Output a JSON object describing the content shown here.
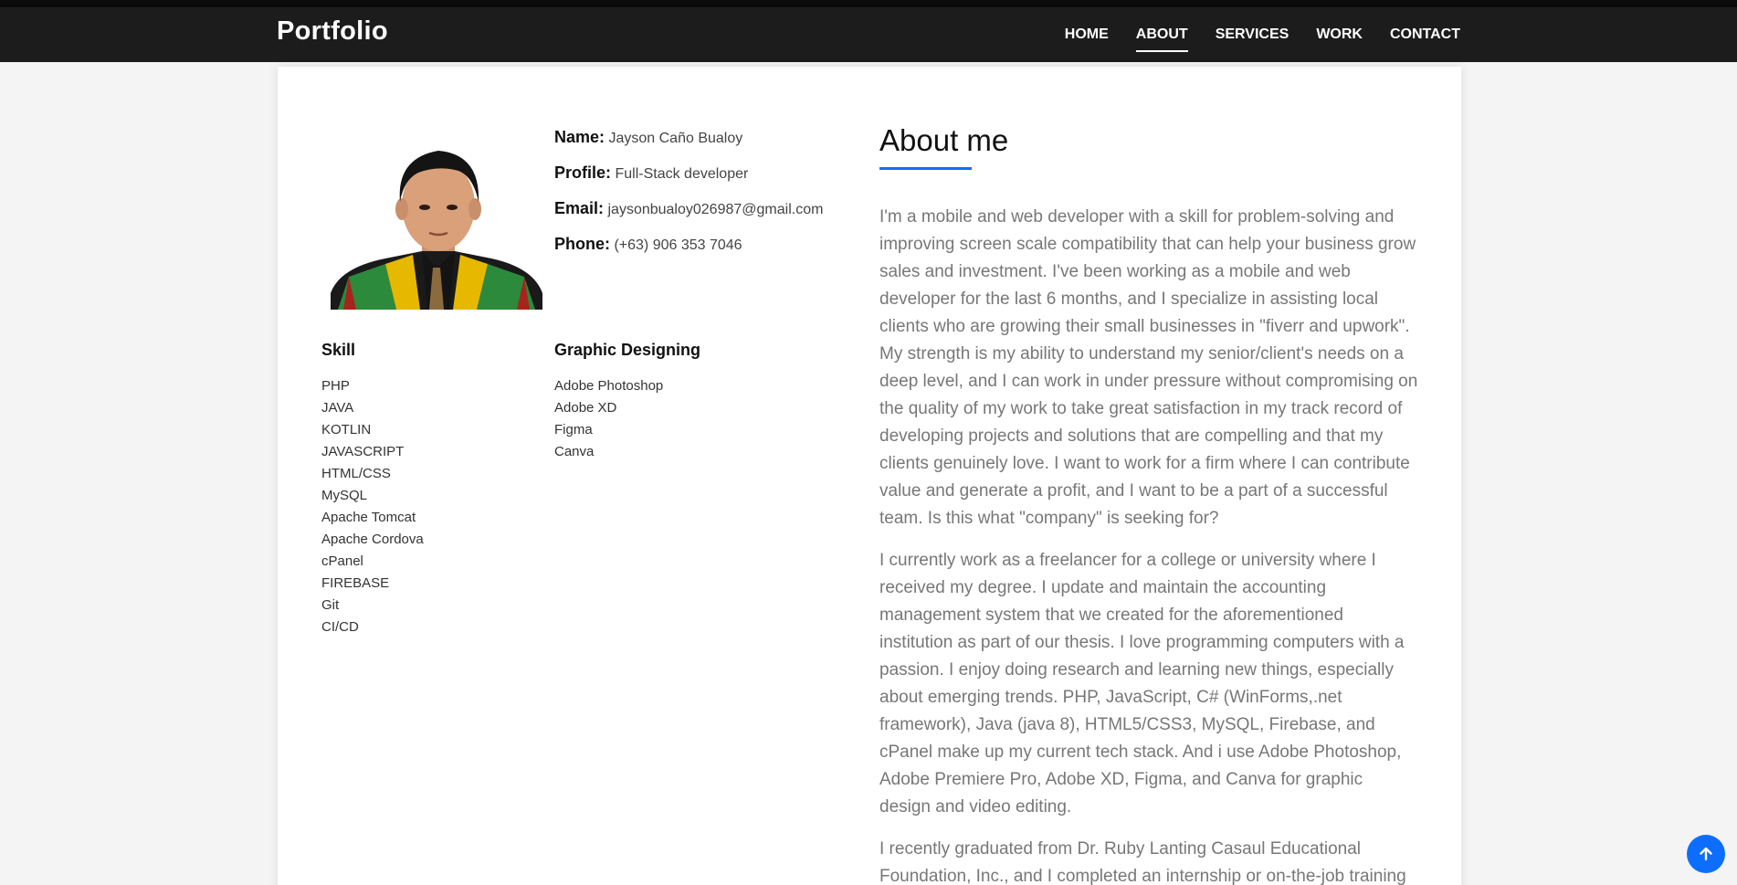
{
  "nav": {
    "brand": "Portfolio",
    "items": [
      {
        "label": "HOME"
      },
      {
        "label": "ABOUT"
      },
      {
        "label": "SERVICES"
      },
      {
        "label": "WORK"
      },
      {
        "label": "CONTACT"
      }
    ],
    "active": "ABOUT"
  },
  "profile": {
    "name_label": "Name:",
    "name": "Jayson Caño Bualoy",
    "profile_label": "Profile:",
    "profile": "Full-Stack developer",
    "email_label": "Email:",
    "email": "jaysonbualoy026987@gmail.com",
    "phone_label": "Phone:",
    "phone": "(+63) 906 353 7046"
  },
  "skills": {
    "title": "Skill",
    "items": [
      "PHP",
      "JAVA",
      "KOTLIN",
      "JAVASCRIPT",
      "HTML/CSS",
      "MySQL",
      "Apache Tomcat",
      "Apache Cordova",
      "cPanel",
      "FIREBASE",
      "Git",
      "CI/CD"
    ]
  },
  "graphics": {
    "title": "Graphic Designing",
    "items": [
      "Adobe Photoshop",
      "Adobe XD",
      "Figma",
      "Canva"
    ]
  },
  "about": {
    "title": "About me",
    "paragraphs": [
      "I'm a mobile and web developer with a skill for problem-solving and improving screen scale compatibility that can help your business grow sales and investment. I've been working as a mobile and web developer for the last 6 months, and I specialize in assisting local clients who are growing their small businesses in \"fiverr and upwork\". My strength is my ability to understand my senior/client's needs on a deep level, and I can work in under pressure without compromising on the quality of my work to take great satisfaction in my track record of developing projects and solutions that are compelling and that my clients genuinely love. I want to work for a firm where I can contribute value and generate a profit, and I want to be a part of a successful team. Is this what \"company\" is seeking for?",
      "I currently work as a freelancer for a college or university where I received my degree. I update and maintain the accounting management system that we created for the aforementioned institution as part of our thesis. I love programming computers with a passion. I enjoy doing research and learning new things, especially about emerging trends. PHP, JavaScript, C# (WinForms,.net framework), Java (java 8), HTML5/CSS3, MySQL, Firebase, and cPanel make up my current tech stack. And i use Adobe Photoshop, Adobe Premiere Pro, Adobe XD, Figma, and Canva for graphic design and video editing.",
      "I recently graduated from Dr. Ruby Lanting Casaul Educational Foundation, Inc., and I completed an internship or on-the-job training"
    ]
  },
  "colors": {
    "accent": "#0d6efd",
    "navbar": "#1c1c1c"
  },
  "icons": {
    "scroll_top": "arrow-up-icon"
  }
}
